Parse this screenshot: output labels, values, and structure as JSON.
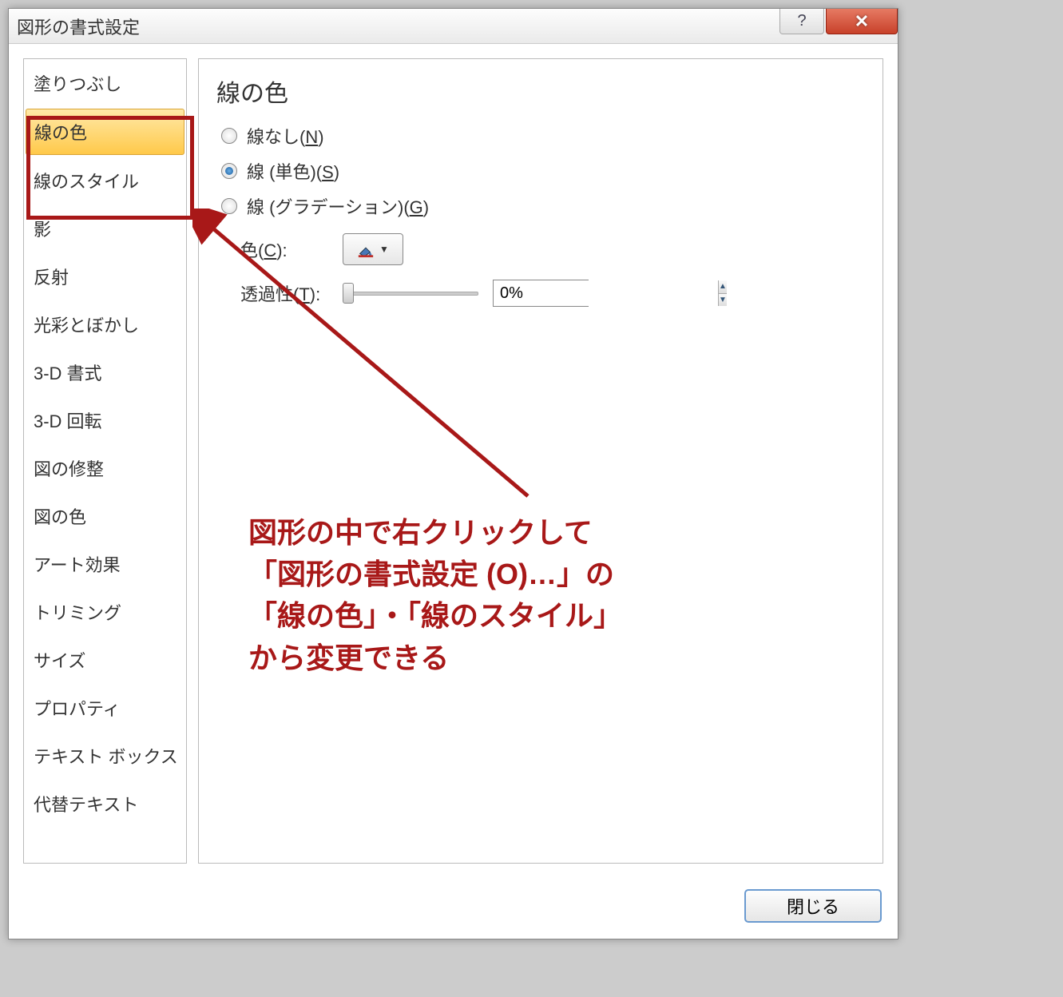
{
  "dialog": {
    "title": "図形の書式設定",
    "helpSymbol": "?",
    "closeSymbol": "✕"
  },
  "sidebar": {
    "items": [
      {
        "label": "塗りつぶし",
        "selected": false
      },
      {
        "label": "線の色",
        "selected": true
      },
      {
        "label": "線のスタイル",
        "selected": false
      },
      {
        "label": "影",
        "selected": false
      },
      {
        "label": "反射",
        "selected": false
      },
      {
        "label": "光彩とぼかし",
        "selected": false
      },
      {
        "label": "3-D 書式",
        "selected": false
      },
      {
        "label": "3-D 回転",
        "selected": false
      },
      {
        "label": "図の修整",
        "selected": false
      },
      {
        "label": "図の色",
        "selected": false
      },
      {
        "label": "アート効果",
        "selected": false
      },
      {
        "label": "トリミング",
        "selected": false
      },
      {
        "label": "サイズ",
        "selected": false
      },
      {
        "label": "プロパティ",
        "selected": false
      },
      {
        "label": "テキスト ボックス",
        "selected": false
      },
      {
        "label": "代替テキスト",
        "selected": false
      }
    ]
  },
  "content": {
    "sectionTitle": "線の色",
    "radios": [
      {
        "label": "線なし",
        "accel": "N",
        "checked": false
      },
      {
        "label": "線 (単色)",
        "accel": "S",
        "checked": true
      },
      {
        "label": "線 (グラデーション)",
        "accel": "G",
        "checked": false
      }
    ],
    "colorLabel": "色",
    "colorAccel": "C",
    "transparencyLabel": "透過性",
    "transparencyAccel": "T",
    "transparencyValue": "0%"
  },
  "footer": {
    "closeLabel": "閉じる"
  },
  "annotation": {
    "line1": "図形の中で右クリックして",
    "line2": "「図形の書式設定 (O)…」の",
    "line3": "「線の色」・「線のスタイル」",
    "line4": "から変更できる"
  }
}
